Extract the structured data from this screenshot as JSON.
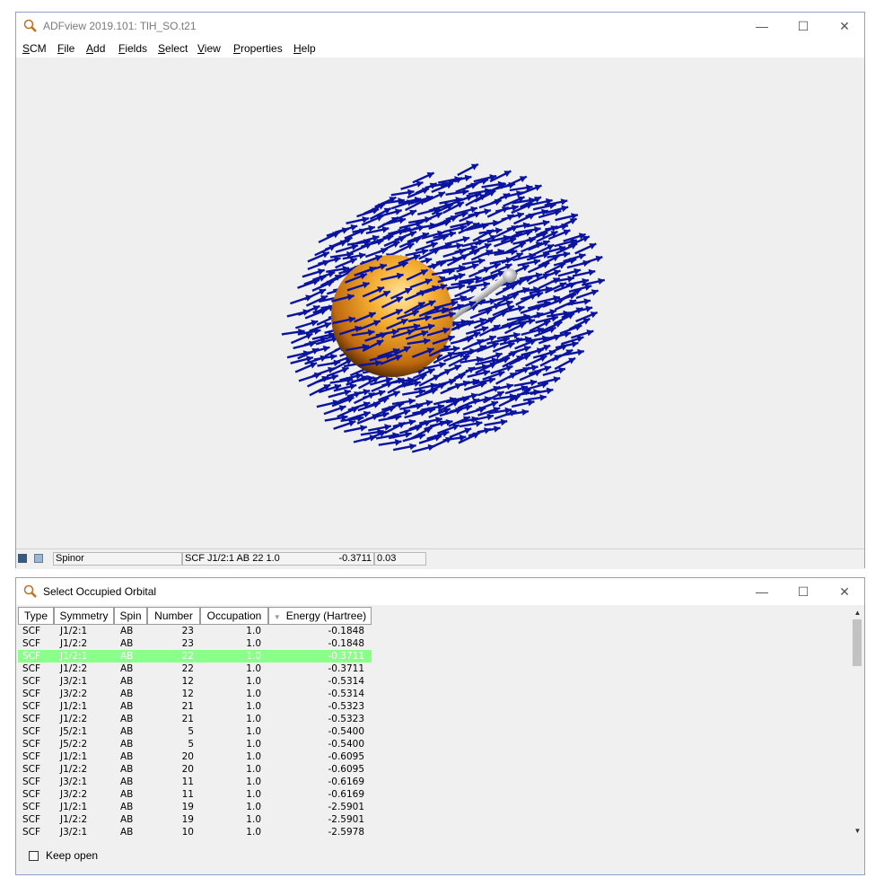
{
  "main_window": {
    "title": "ADFview 2019.101: TlH_SO.t21",
    "menu": [
      {
        "label": "SCM",
        "u": "S",
        "rest": "CM"
      },
      {
        "label": "File",
        "u": "F",
        "rest": "ile"
      },
      {
        "label": "Add",
        "u": "A",
        "rest": "dd"
      },
      {
        "label": "Fields",
        "u": "F",
        "rest": "ields"
      },
      {
        "label": "Select",
        "u": "S",
        "rest": "elect"
      },
      {
        "label": "View",
        "u": "V",
        "rest": "iew"
      },
      {
        "label": "Properties",
        "u": "P",
        "rest": "roperties"
      },
      {
        "label": "Help",
        "u": "H",
        "rest": "elp"
      }
    ],
    "status": {
      "field_name": "Spinor",
      "orbital": "SCF J1/2:1 AB 22 1.0",
      "energy": "-0.3711",
      "value": "0.03"
    },
    "controls": {
      "minimize": "—",
      "maximize": "☐",
      "close": "✕"
    }
  },
  "orbital_window": {
    "title": "Select Occupied Orbital",
    "controls": {
      "minimize": "—",
      "maximize": "☐",
      "close": "✕"
    },
    "columns": [
      "Type",
      "Symmetry",
      "Spin",
      "Number",
      "Occupation",
      "Energy (Hartree)"
    ],
    "sort_indicator": "▼",
    "rows": [
      [
        "SCF",
        "J1/2:1",
        "AB",
        "23",
        "1.0",
        "-0.1848"
      ],
      [
        "SCF",
        "J1/2:2",
        "AB",
        "23",
        "1.0",
        "-0.1848"
      ],
      [
        "SCF",
        "J1/2:1",
        "AB",
        "22",
        "1.0",
        "-0.3711"
      ],
      [
        "SCF",
        "J1/2:2",
        "AB",
        "22",
        "1.0",
        "-0.3711"
      ],
      [
        "SCF",
        "J3/2:1",
        "AB",
        "12",
        "1.0",
        "-0.5314"
      ],
      [
        "SCF",
        "J3/2:2",
        "AB",
        "12",
        "1.0",
        "-0.5314"
      ],
      [
        "SCF",
        "J1/2:1",
        "AB",
        "21",
        "1.0",
        "-0.5323"
      ],
      [
        "SCF",
        "J1/2:2",
        "AB",
        "21",
        "1.0",
        "-0.5323"
      ],
      [
        "SCF",
        "J5/2:1",
        "AB",
        "5",
        "1.0",
        "-0.5400"
      ],
      [
        "SCF",
        "J5/2:2",
        "AB",
        "5",
        "1.0",
        "-0.5400"
      ],
      [
        "SCF",
        "J1/2:1",
        "AB",
        "20",
        "1.0",
        "-0.6095"
      ],
      [
        "SCF",
        "J1/2:2",
        "AB",
        "20",
        "1.0",
        "-0.6095"
      ],
      [
        "SCF",
        "J3/2:1",
        "AB",
        "11",
        "1.0",
        "-0.6169"
      ],
      [
        "SCF",
        "J3/2:2",
        "AB",
        "11",
        "1.0",
        "-0.6169"
      ],
      [
        "SCF",
        "J1/2:1",
        "AB",
        "19",
        "1.0",
        "-2.5901"
      ],
      [
        "SCF",
        "J1/2:2",
        "AB",
        "19",
        "1.0",
        "-2.5901"
      ],
      [
        "SCF",
        "J3/2:1",
        "AB",
        "10",
        "1.0",
        "-2.5978"
      ]
    ],
    "selected_row": 2,
    "keep_open_label": "Keep open",
    "keep_open_checked": false
  },
  "colors": {
    "arrow": "#0a14a0",
    "atom": "#f0a020",
    "selection": "#8aff8a"
  }
}
